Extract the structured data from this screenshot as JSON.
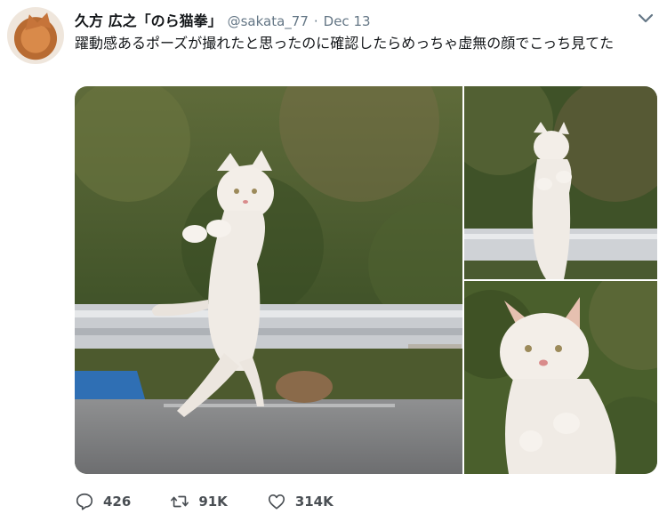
{
  "tweet": {
    "author_name": "久方 広之「のら猫拳」",
    "handle": "@sakata_77",
    "separator": "·",
    "date": "Dec 13",
    "text": "躍動感あるポーズが撮れたと思ったのに確認したらめっちゃ虚無の顔でこっち見てた"
  },
  "actions": {
    "replies": "426",
    "retweets": "91K",
    "likes": "314K"
  },
  "colors": {
    "text": "#14171a",
    "secondary": "#657786",
    "background": "#ffffff"
  },
  "icons": {
    "chevron": "chevron-down-icon",
    "reply": "reply-icon",
    "retweet": "retweet-icon",
    "like": "heart-icon"
  }
}
